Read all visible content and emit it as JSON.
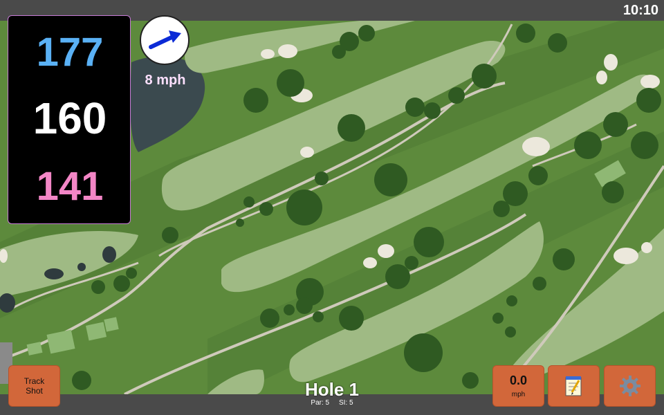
{
  "status": {
    "time": "10:10"
  },
  "distances": {
    "back": "177",
    "middle": "160",
    "front": "141",
    "colors": {
      "back": "#5ab1f5",
      "middle": "#ffffff",
      "front": "#f386c6"
    }
  },
  "wind": {
    "speed_label": "8 mph",
    "arrow_color": "#0b2ad6"
  },
  "hole": {
    "title": "Hole 1",
    "par_label": "Par: 5",
    "si_label": "SI: 5"
  },
  "buttons": {
    "track_shot": {
      "line1": "Track",
      "line2": "Shot"
    },
    "speed": {
      "value": "0.0",
      "unit": "mph"
    },
    "notes_icon": "notepad-icon",
    "settings_icon": "gear-icon"
  },
  "colors": {
    "button": "#d2673a",
    "fairway": "#9fba84",
    "rough": "#5f8b3e",
    "path": "#cfcabb",
    "sand": "#ece8dc",
    "water": "#3b4a4f"
  }
}
